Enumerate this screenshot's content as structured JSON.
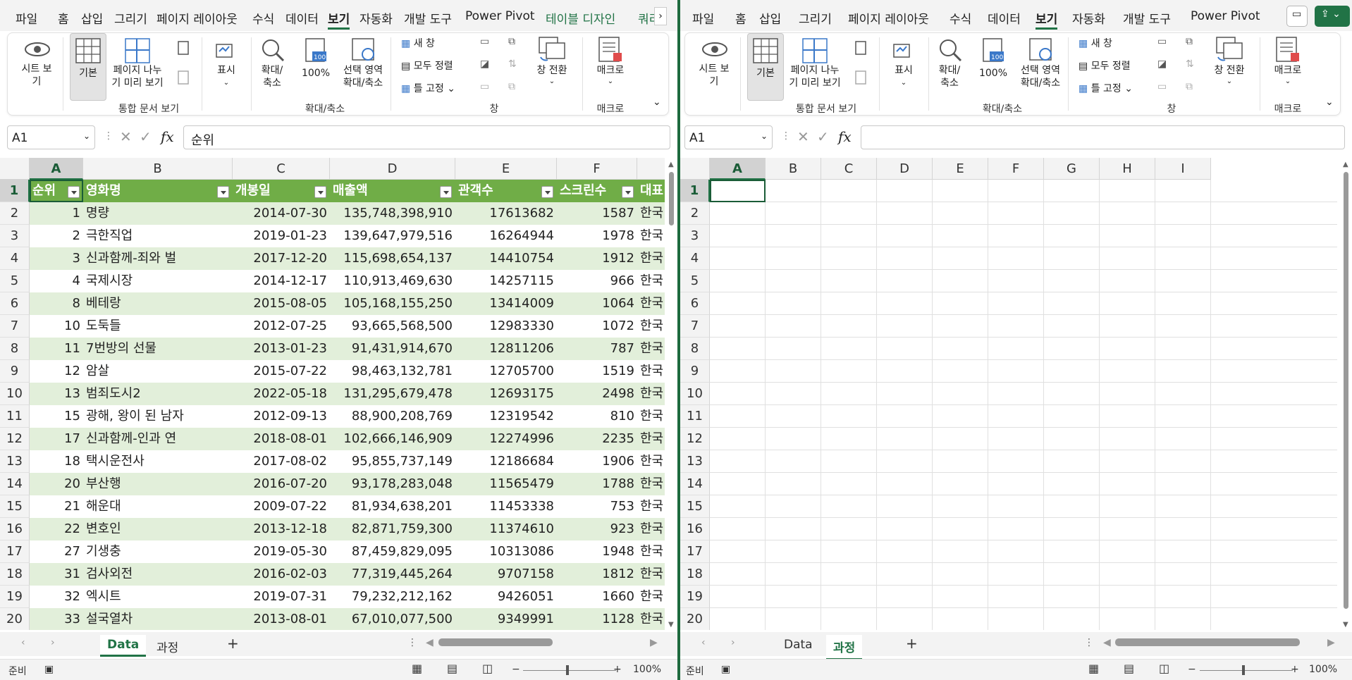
{
  "tabs_left": [
    "파일",
    "홈",
    "삽입",
    "그리기",
    "페이지 레이아웃",
    "수식",
    "데이터",
    "보기",
    "자동화",
    "개발 도구",
    "Power Pivot",
    "테이블 디자인",
    "쿼리"
  ],
  "tabs_right": [
    "파일",
    "홈",
    "삽입",
    "그리기",
    "페이지 레이아웃",
    "수식",
    "데이터",
    "보기",
    "자동화",
    "개발 도구",
    "Power Pivot"
  ],
  "active_tab": "보기",
  "ribbon": {
    "sheet_view": "시트 보\n기",
    "normal": "기본",
    "page_break": "페이지 나누\n기 미리 보기",
    "show": "표시",
    "zoom": "확대/\n축소",
    "zoom100": "100%",
    "zoom_sel": "선택 영역\n확대/축소",
    "new_window": "새 창",
    "arrange_all": "모두 정렬",
    "freeze": "틀 고정",
    "switch_window": "창 전환",
    "macro": "매크로",
    "grp_workbook": "통합 문서 보기",
    "grp_zoom": "확대/축소",
    "grp_window": "창",
    "grp_macro": "매크로"
  },
  "left": {
    "namebox": "A1",
    "formula": "순위",
    "columns": [
      "A",
      "B",
      "C",
      "D",
      "E",
      "F"
    ],
    "headers": [
      "순위",
      "영화명",
      "개봉일",
      "매출액",
      "관객수",
      "스크린수",
      "대표"
    ],
    "rows": [
      [
        "1",
        "명량",
        "2014-07-30",
        "135,748,398,910",
        "17613682",
        "1587",
        "한국"
      ],
      [
        "2",
        "극한직업",
        "2019-01-23",
        "139,647,979,516",
        "16264944",
        "1978",
        "한국"
      ],
      [
        "3",
        "신과함께-죄와 벌",
        "2017-12-20",
        "115,698,654,137",
        "14410754",
        "1912",
        "한국"
      ],
      [
        "4",
        "국제시장",
        "2014-12-17",
        "110,913,469,630",
        "14257115",
        "966",
        "한국"
      ],
      [
        "8",
        "베테랑",
        "2015-08-05",
        "105,168,155,250",
        "13414009",
        "1064",
        "한국"
      ],
      [
        "10",
        "도둑들",
        "2012-07-25",
        "93,665,568,500",
        "12983330",
        "1072",
        "한국"
      ],
      [
        "11",
        "7번방의 선물",
        "2013-01-23",
        "91,431,914,670",
        "12811206",
        "787",
        "한국"
      ],
      [
        "12",
        "암살",
        "2015-07-22",
        "98,463,132,781",
        "12705700",
        "1519",
        "한국"
      ],
      [
        "13",
        "범죄도시2",
        "2022-05-18",
        "131,295,679,478",
        "12693175",
        "2498",
        "한국"
      ],
      [
        "15",
        "광해, 왕이 된 남자",
        "2012-09-13",
        "88,900,208,769",
        "12319542",
        "810",
        "한국"
      ],
      [
        "17",
        "신과함께-인과 연",
        "2018-08-01",
        "102,666,146,909",
        "12274996",
        "2235",
        "한국"
      ],
      [
        "18",
        "택시운전사",
        "2017-08-02",
        "95,855,737,149",
        "12186684",
        "1906",
        "한국"
      ],
      [
        "20",
        "부산행",
        "2016-07-20",
        "93,178,283,048",
        "11565479",
        "1788",
        "한국"
      ],
      [
        "21",
        "해운대",
        "2009-07-22",
        "81,934,638,201",
        "11453338",
        "753",
        "한국"
      ],
      [
        "22",
        "변호인",
        "2013-12-18",
        "82,871,759,300",
        "11374610",
        "923",
        "한국"
      ],
      [
        "27",
        "기생충",
        "2019-05-30",
        "87,459,829,095",
        "10313086",
        "1948",
        "한국"
      ],
      [
        "31",
        "검사외전",
        "2016-02-03",
        "77,319,445,264",
        "9707158",
        "1812",
        "한국"
      ],
      [
        "32",
        "엑시트",
        "2019-07-31",
        "79,232,212,162",
        "9426051",
        "1660",
        "한국"
      ],
      [
        "33",
        "설국열차",
        "2013-08-01",
        "67,010,077,500",
        "9349991",
        "1128",
        "한국"
      ]
    ],
    "sheets": [
      "Data",
      "과정"
    ],
    "active_sheet": "Data"
  },
  "right": {
    "namebox": "A1",
    "formula": "",
    "columns": [
      "A",
      "B",
      "C",
      "D",
      "E",
      "F",
      "G",
      "H",
      "I"
    ],
    "sheets": [
      "Data",
      "과정"
    ],
    "active_sheet": "과정"
  },
  "row_numbers": [
    "1",
    "2",
    "3",
    "4",
    "5",
    "6",
    "7",
    "8",
    "9",
    "10",
    "11",
    "12",
    "13",
    "14",
    "15",
    "16",
    "17",
    "18",
    "19",
    "20"
  ],
  "status": {
    "ready": "준비",
    "zoom": "100%"
  },
  "colors": {
    "accent": "#217346",
    "header": "#70ad47",
    "band": "#e2efda"
  }
}
